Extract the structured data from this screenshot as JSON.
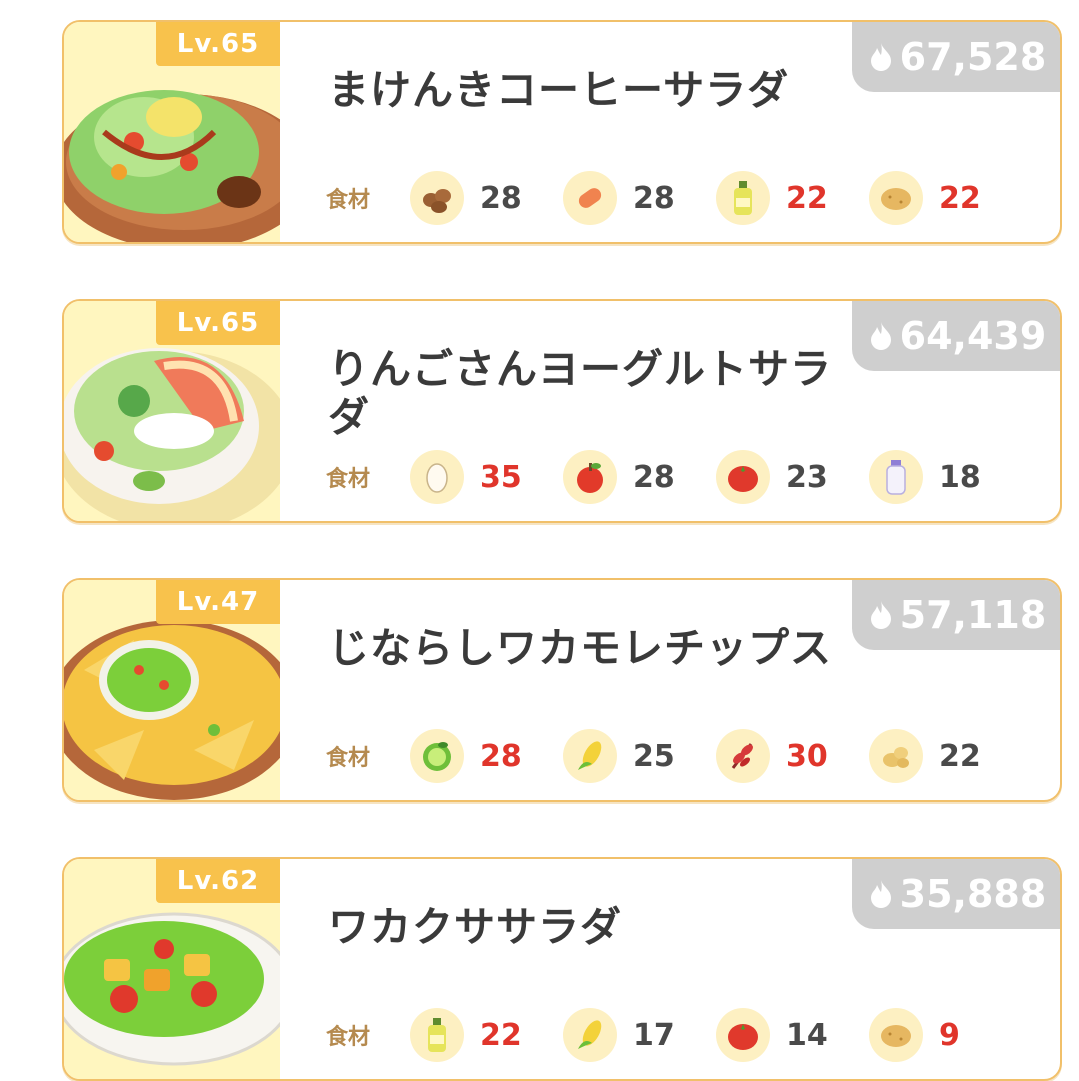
{
  "recipes": [
    {
      "level": "Lv.65",
      "title": "まけんきコーヒーサラダ",
      "energy": "67,528",
      "ingredients_label": "食材",
      "ingredients": [
        {
          "icon": "cacao-beans-icon",
          "count": "28",
          "short": false
        },
        {
          "icon": "sausage-icon",
          "count": "28",
          "short": false
        },
        {
          "icon": "oil-bottle-icon",
          "count": "22",
          "short": true
        },
        {
          "icon": "potato-icon",
          "count": "22",
          "short": true
        }
      ]
    },
    {
      "level": "Lv.65",
      "title": "りんごさんヨーグルトサラダ",
      "energy": "64,439",
      "ingredients_label": "食材",
      "ingredients": [
        {
          "icon": "egg-icon",
          "count": "35",
          "short": true
        },
        {
          "icon": "apple-icon",
          "count": "28",
          "short": false
        },
        {
          "icon": "tomato-icon",
          "count": "23",
          "short": false
        },
        {
          "icon": "milk-bottle-icon",
          "count": "18",
          "short": false
        }
      ]
    },
    {
      "level": "Lv.47",
      "title": "じならしワカモレチップス",
      "energy": "57,118",
      "ingredients_label": "食材",
      "ingredients": [
        {
          "icon": "avocado-icon",
          "count": "28",
          "short": true
        },
        {
          "icon": "corn-icon",
          "count": "25",
          "short": false
        },
        {
          "icon": "herb-icon",
          "count": "30",
          "short": true
        },
        {
          "icon": "ginger-icon",
          "count": "22",
          "short": false
        }
      ]
    },
    {
      "level": "Lv.62",
      "title": "ワカクササラダ",
      "energy": "35,888",
      "ingredients_label": "食材",
      "ingredients": [
        {
          "icon": "oil-bottle-icon",
          "count": "22",
          "short": true
        },
        {
          "icon": "corn-icon",
          "count": "17",
          "short": false
        },
        {
          "icon": "tomato-icon",
          "count": "14",
          "short": false
        },
        {
          "icon": "potato-icon",
          "count": "9",
          "short": true
        }
      ]
    }
  ],
  "colors": {
    "card_border": "#f1c06a",
    "level_badge": "#f8c24c",
    "energy_badge": "#cfcfcf",
    "shortage": "#e0352b",
    "thumb_bg": "#fff6bf"
  }
}
